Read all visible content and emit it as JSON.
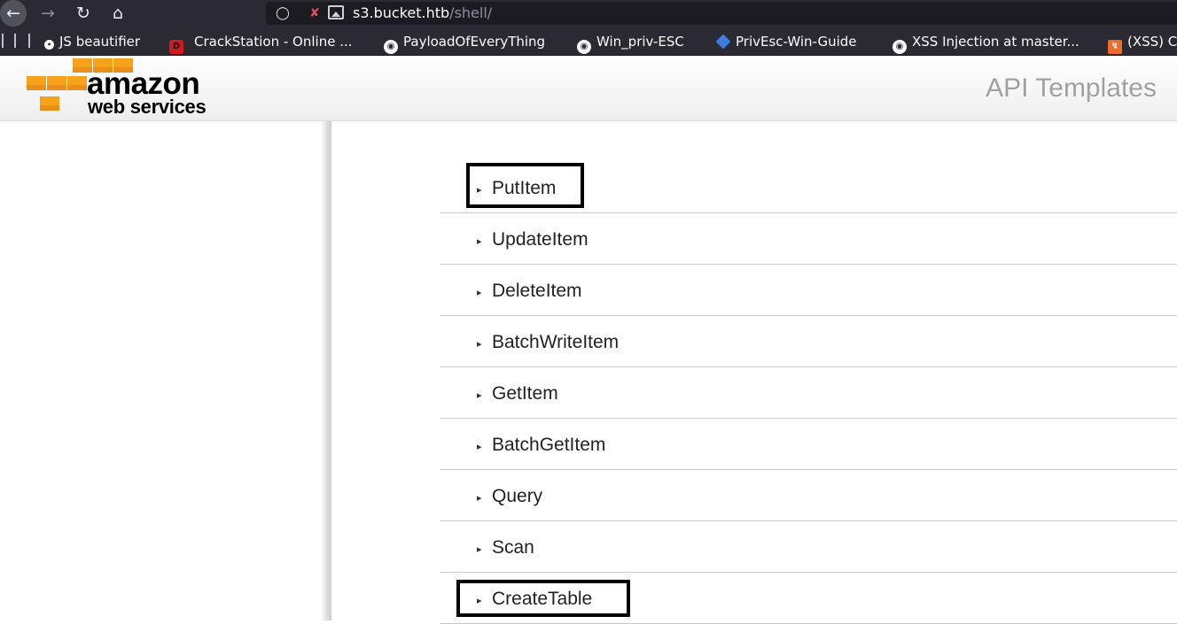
{
  "browser": {
    "url_host": "s3.bucket.htb",
    "url_path": "/shell/",
    "bookmarks": [
      {
        "label": "JS beautifier",
        "icon": "bug-icon"
      },
      {
        "label": "CrackStation - Online ...",
        "icon": "crackstation-icon"
      },
      {
        "label": "PayloadOfEveryThing",
        "icon": "github-icon"
      },
      {
        "label": "Win_priv-ESC",
        "icon": "github-icon"
      },
      {
        "label": "PrivEsc-Win-Guide",
        "icon": "gitbook-icon"
      },
      {
        "label": "XSS Injection at master...",
        "icon": "github-icon"
      },
      {
        "label": "(XSS) C",
        "icon": "portswigger-icon"
      }
    ]
  },
  "header": {
    "logo_line1": "amazon",
    "logo_line2": "web services",
    "title": "API Templates"
  },
  "templates": [
    {
      "label": "PutItem",
      "highlighted": true
    },
    {
      "label": "UpdateItem",
      "highlighted": false
    },
    {
      "label": "DeleteItem",
      "highlighted": false
    },
    {
      "label": "BatchWriteItem",
      "highlighted": false
    },
    {
      "label": "GetItem",
      "highlighted": false
    },
    {
      "label": "BatchGetItem",
      "highlighted": false
    },
    {
      "label": "Query",
      "highlighted": false
    },
    {
      "label": "Scan",
      "highlighted": false
    },
    {
      "label": "CreateTable",
      "highlighted": true
    }
  ],
  "colors": {
    "chrome_bg": "#2b2a33",
    "aws_orange": "#f7a21b",
    "title_gray": "#a0a0a0",
    "highlight": "#000000"
  }
}
